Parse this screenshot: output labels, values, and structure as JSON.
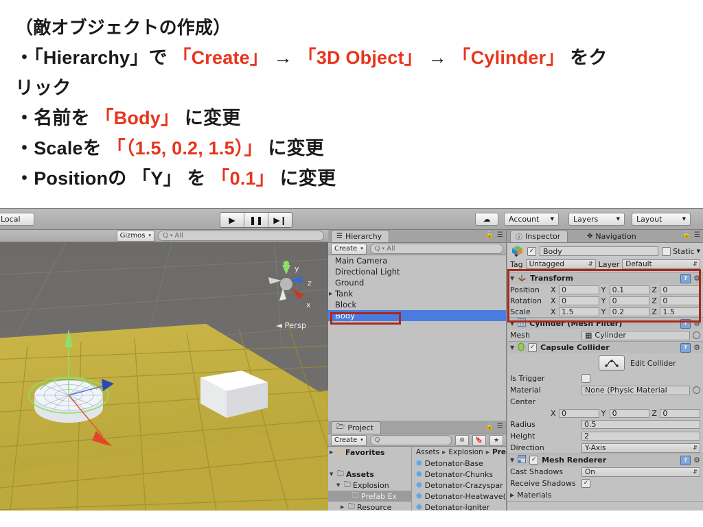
{
  "slide": {
    "lines": [
      [
        {
          "t": "（敵オブジェクトの作成）",
          "c": "black"
        }
      ],
      [
        {
          "t": "・「Hierarchy」で ",
          "c": "black"
        },
        {
          "t": "「Create」",
          "c": "red"
        },
        {
          "t": " → ",
          "c": "black"
        },
        {
          "t": "「3D Object」",
          "c": "red"
        },
        {
          "t": " → ",
          "c": "black"
        },
        {
          "t": "「Cylinder」",
          "c": "red"
        },
        {
          "t": " をク",
          "c": "black"
        }
      ],
      [
        {
          "t": "リック",
          "c": "black"
        }
      ],
      [
        {
          "t": "・名前を ",
          "c": "black"
        },
        {
          "t": "「Body」",
          "c": "red"
        },
        {
          "t": " に変更",
          "c": "black"
        }
      ],
      [
        {
          "t": "・Scaleを ",
          "c": "black"
        },
        {
          "t": "「（1.5, 0.2, 1.5）」",
          "c": "red"
        },
        {
          "t": " に変更",
          "c": "black"
        }
      ],
      [
        {
          "t": "・Positionの 「Y」 を ",
          "c": "black"
        },
        {
          "t": "「0.1」",
          "c": "red"
        },
        {
          "t": " に変更",
          "c": "black"
        }
      ]
    ],
    "accent_color": "#e8341c",
    "text_color": "#1a1a1a"
  },
  "toolbar": {
    "pivot_mode_label": "Local",
    "play_icon": "▶",
    "pause_icon": "❚❚",
    "step_icon": "▶❙",
    "cloud_icon": "☁",
    "account_label": "Account",
    "layers_label": "Layers",
    "layout_label": "Layout",
    "caret_icon": "▼"
  },
  "scene": {
    "gizmos_label": "Gizmos",
    "search_placeholder": "All",
    "search_icon": "Q",
    "axis_y_label": "y",
    "axis_z_label": "z",
    "axis_x_label": "x",
    "persp_label": "Persp",
    "persp_prefix": "◄",
    "ground_color": "#c1ad3f",
    "sky_color": "#6e6c6a"
  },
  "hierarchy": {
    "tab_label": "Hierarchy",
    "tab_icon": "☰",
    "lock_icon": "🔒",
    "menu_icon": "▾☰",
    "create_label": "Create",
    "create_caret": "▾",
    "search_placeholder": "All",
    "search_icon": "Q",
    "items": [
      {
        "label": "Main Camera",
        "expand": "",
        "selected": false
      },
      {
        "label": "Directional Light",
        "expand": "",
        "selected": false
      },
      {
        "label": "Ground",
        "expand": "",
        "selected": false
      },
      {
        "label": "Tank",
        "expand": "▶",
        "selected": false
      },
      {
        "label": "Block",
        "expand": "",
        "selected": false
      },
      {
        "label": "Body",
        "expand": "",
        "selected": true
      }
    ],
    "selection_color": "#4a7ce0"
  },
  "project": {
    "tab_label": "Project",
    "tab_icon": "🗀",
    "lock_icon": "🔒",
    "menu_icon": "▾☰",
    "create_label": "Create",
    "create_caret": "▾",
    "search_icon": "Q",
    "search_placeholder": "",
    "icon_buttons": [
      "filter-by-type-icon",
      "filter-by-label-icon",
      "favorites-star-icon"
    ],
    "tree": [
      {
        "label": "Favorites",
        "tri": "▶",
        "ico": "★",
        "selected": false,
        "indent": 2
      },
      {
        "label": "",
        "tri": "",
        "ico": "",
        "selected": false,
        "indent": 2,
        "spacer": true
      },
      {
        "label": "Assets",
        "tri": "▼",
        "ico": "🗀",
        "selected": false,
        "indent": 2
      },
      {
        "label": "Explosion",
        "tri": "▼",
        "ico": "🗀",
        "selected": false,
        "indent": 12
      },
      {
        "label": "Prefab Ex",
        "tri": "",
        "ico": "🗀",
        "selected": true,
        "indent": 24
      },
      {
        "label": "Resource",
        "tri": "▶",
        "ico": "🗀",
        "selected": false,
        "indent": 18
      }
    ],
    "breadcrumbs": [
      "Assets",
      "Explosion",
      "Pre"
    ],
    "breadcrumb_sep": "▸",
    "assets": [
      "Detonator-Base",
      "Detonator-Chunks",
      "Detonator-Crazyspar",
      "Detonator-Heatwave(",
      "Detonator-Igniter"
    ]
  },
  "inspector": {
    "tab_label": "Inspector",
    "tab_icon": "ⓘ",
    "nav_tab_label": "Navigation",
    "nav_tab_icon": "✥",
    "lock_icon": "🔒",
    "menu_icon": "▾☰",
    "object_enabled": true,
    "object_name": "Body",
    "static_label": "Static",
    "static_checked": false,
    "static_caret": "▼",
    "tag_label": "Tag",
    "tag_value": "Untagged",
    "layer_label": "Layer",
    "layer_value": "Default",
    "transform": {
      "title": "Transform",
      "icon": "transform-axes-icon",
      "rows": [
        {
          "label": "Position",
          "x": "0",
          "y": "0.1",
          "z": "0"
        },
        {
          "label": "Rotation",
          "x": "0",
          "y": "0",
          "z": "0"
        },
        {
          "label": "Scale",
          "x": "1.5",
          "y": "0.2",
          "z": "1.5"
        }
      ],
      "axis_labels": [
        "X",
        "Y",
        "Z"
      ],
      "help_icon": "?",
      "gear_icon": "⚙"
    },
    "mesh_filter": {
      "title": "Cylinder (Mesh Filter)",
      "mesh_label": "Mesh",
      "mesh_value": "Cylinder"
    },
    "capsule_collider": {
      "title": "Capsule Collider",
      "enabled": true,
      "edit_collider_label": "Edit Collider",
      "is_trigger_label": "Is Trigger",
      "is_trigger_checked": false,
      "material_label": "Material",
      "material_value": "None (Physic Material",
      "center_label": "Center",
      "center": {
        "x": "0",
        "y": "0",
        "z": "0"
      },
      "radius_label": "Radius",
      "radius_value": "0.5",
      "height_label": "Height",
      "height_value": "2",
      "direction_label": "Direction",
      "direction_value": "Y-Axis"
    },
    "mesh_renderer": {
      "title": "Mesh Renderer",
      "enabled": true,
      "cast_shadows_label": "Cast Shadows",
      "cast_shadows_value": "On",
      "receive_shadows_label": "Receive Shadows",
      "receive_shadows_checked": true,
      "materials_label": "Materials",
      "materials_tri": "▶"
    },
    "annotation_color": "#a8291a"
  }
}
